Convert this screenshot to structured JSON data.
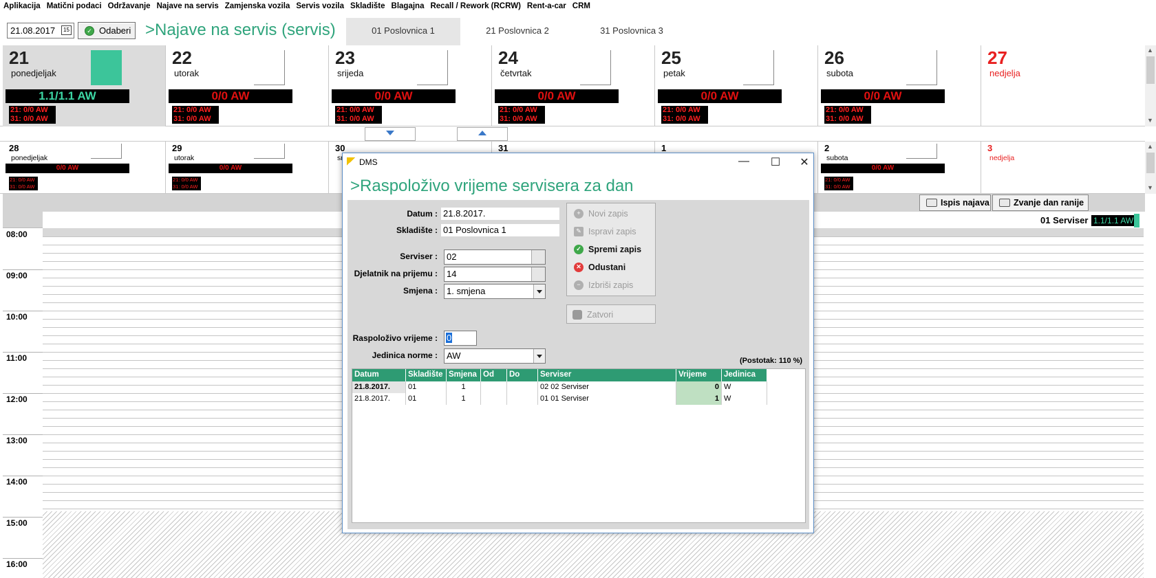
{
  "menu": [
    "Aplikacija",
    "Matični podaci",
    "Održavanje",
    "Najave na servis",
    "Zamjenska vozila",
    "Servis vozila",
    "Skladište",
    "Blagajna",
    "Recall / Rework (RCRW)",
    "Rent-a-car",
    "CRM"
  ],
  "toolbar": {
    "date_value": "21.08.2017",
    "cal_glyph": "15",
    "odaberi_label": "Odaberi",
    "title": ">Najave na servis (servis)",
    "tabs": [
      "01 Poslovnica 1",
      "21 Poslovnica 2",
      "31 Poslovnica 3"
    ],
    "active_tab": 0
  },
  "week1": [
    {
      "num": "21",
      "name": "ponedjeljak",
      "aw": "1.1/1.1 AW",
      "sub1": "21: 0/0 AW",
      "sub2": "31: 0/0 AW",
      "selected": true
    },
    {
      "num": "22",
      "name": "utorak",
      "aw": "0/0 AW",
      "sub1": "21: 0/0 AW",
      "sub2": "31: 0/0 AW"
    },
    {
      "num": "23",
      "name": "srijeda",
      "aw": "0/0 AW",
      "sub1": "21: 0/0 AW",
      "sub2": "31: 0/0 AW"
    },
    {
      "num": "24",
      "name": "četvrtak",
      "aw": "0/0 AW",
      "sub1": "21: 0/0 AW",
      "sub2": "31: 0/0 AW"
    },
    {
      "num": "25",
      "name": "petak",
      "aw": "0/0 AW",
      "sub1": "21: 0/0 AW",
      "sub2": "31: 0/0 AW"
    },
    {
      "num": "26",
      "name": "subota",
      "aw": "0/0 AW",
      "sub1": "21: 0/0 AW",
      "sub2": "31: 0/0 AW"
    },
    {
      "num": "27",
      "name": "nedjelja"
    }
  ],
  "week2": [
    {
      "num": "28",
      "name": "ponedjeljak",
      "aw": "0/0 AW",
      "sub1": "21: 0/0 AW",
      "sub2": "31: 0/0 AW"
    },
    {
      "num": "29",
      "name": "utorak",
      "aw": "0/0 AW",
      "sub1": "21: 0/0 AW",
      "sub2": "31: 0/0 AW"
    },
    {
      "num": "30",
      "name": "sr"
    },
    {
      "num": "31",
      "name": ""
    },
    {
      "num": "1",
      "name": ""
    },
    {
      "num": "2",
      "name": "subota",
      "aw": "0/0 AW",
      "sub1": "21: 0/0 AW",
      "sub2": "31: 0/0 AW"
    },
    {
      "num": "3",
      "name": "nedjelja"
    }
  ],
  "lower": {
    "print_label": "Ispis najava",
    "call_label": "Zvanje dan ranije",
    "serviser": "01 Serviser",
    "serviser_aw": "1.1/1.1 AW",
    "times": [
      "08:00",
      "09:00",
      "10:00",
      "11:00",
      "12:00",
      "13:00",
      "14:00",
      "15:00",
      "16:00"
    ]
  },
  "dialog": {
    "window_title": "DMS",
    "heading": ">Raspoloživo vrijeme servisera za dan",
    "labels": {
      "datum": "Datum :",
      "skladiste": "Skladište :",
      "serviser": "Serviser :",
      "djelatnik": "Djelatnik na prijemu :",
      "smjena": "Smjena :",
      "raspolozivo": "Raspoloživo vrijeme :",
      "jedinica": "Jedinica norme :"
    },
    "values": {
      "datum": "21.8.2017.",
      "skladiste": "01 Poslovnica 1",
      "serviser": "02",
      "djelatnik": "14",
      "smjena": "1. smjena",
      "raspolozivo": "0",
      "jedinica": "AW"
    },
    "actions": {
      "novi": "Novi zapis",
      "ispravi": "Ispravi zapis",
      "spremi": "Spremi zapis",
      "odustani": "Odustani",
      "izbrisi": "Izbriši zapis",
      "zatvori": "Zatvori"
    },
    "postotak": "(Postotak: 110 %)",
    "table": {
      "headers": [
        "Datum",
        "Skladište",
        "Smjena",
        "Od",
        "Do",
        "Serviser",
        "Vrijeme",
        "Jedinica"
      ],
      "rows": [
        [
          "21.8.2017.",
          "01",
          "1",
          "",
          "",
          "02 02 Serviser",
          "0",
          "W"
        ],
        [
          "21.8.2017.",
          "01",
          "1",
          "",
          "",
          "01 01 Serviser",
          "1",
          "W"
        ]
      ]
    }
  }
}
